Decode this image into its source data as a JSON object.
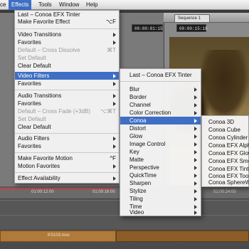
{
  "menubar": {
    "items": [
      {
        "label": "ce"
      },
      {
        "label": "Effects"
      },
      {
        "label": "Tools"
      },
      {
        "label": "Window"
      },
      {
        "label": "Help"
      }
    ]
  },
  "effects_menu": {
    "items": [
      {
        "label": "Last – Conoa EFX Tinter",
        "shortcut": "",
        "submenu": false,
        "disabled": false
      },
      {
        "label": "Make Favorite Effect",
        "shortcut": "⌥F",
        "submenu": false,
        "disabled": false
      },
      {
        "label": "Video Transitions",
        "shortcut": "",
        "submenu": true,
        "disabled": false
      },
      {
        "label": "Favorites",
        "shortcut": "",
        "submenu": true,
        "disabled": false
      },
      {
        "label": "Default – Cross Dissolve",
        "shortcut": "⌘T",
        "submenu": false,
        "disabled": true
      },
      {
        "label": "Set Default",
        "shortcut": "",
        "submenu": false,
        "disabled": true
      },
      {
        "label": "Clear Default",
        "shortcut": "",
        "submenu": false,
        "disabled": false
      },
      {
        "label": "Video Filters",
        "shortcut": "",
        "submenu": true,
        "disabled": false,
        "highlighted": true
      },
      {
        "label": "Favorites",
        "shortcut": "",
        "submenu": true,
        "disabled": false
      },
      {
        "label": "Audio Transitions",
        "shortcut": "",
        "submenu": true,
        "disabled": false
      },
      {
        "label": "Favorites",
        "shortcut": "",
        "submenu": true,
        "disabled": false
      },
      {
        "label": "Default – Cross Fade (+3dB)",
        "shortcut": "⌥⌘T",
        "submenu": false,
        "disabled": true
      },
      {
        "label": "Set Default",
        "shortcut": "",
        "submenu": false,
        "disabled": true
      },
      {
        "label": "Clear Default",
        "shortcut": "",
        "submenu": false,
        "disabled": false
      },
      {
        "label": "Audio Filters",
        "shortcut": "",
        "submenu": true,
        "disabled": false
      },
      {
        "label": "Favorites",
        "shortcut": "",
        "submenu": true,
        "disabled": false
      },
      {
        "label": "Make Favorite Motion",
        "shortcut": "^F",
        "submenu": false,
        "disabled": false
      },
      {
        "label": "Motion Favorites",
        "shortcut": "",
        "submenu": true,
        "disabled": false
      },
      {
        "label": "Effect Availability",
        "shortcut": "",
        "submenu": true,
        "disabled": false
      }
    ]
  },
  "video_filters_menu": {
    "items": [
      {
        "label": "Last – Conoa EFX Tinter",
        "submenu": false
      },
      {
        "label": "Blur",
        "submenu": true
      },
      {
        "label": "Border",
        "submenu": true
      },
      {
        "label": "Channel",
        "submenu": true
      },
      {
        "label": "Color Correction",
        "submenu": true
      },
      {
        "label": "Conoa",
        "submenu": true,
        "highlighted": true
      },
      {
        "label": "Distort",
        "submenu": true
      },
      {
        "label": "Glow",
        "submenu": true
      },
      {
        "label": "Image Control",
        "submenu": true
      },
      {
        "label": "Key",
        "submenu": true
      },
      {
        "label": "Matte",
        "submenu": true
      },
      {
        "label": "Perspective",
        "submenu": true
      },
      {
        "label": "QuickTime",
        "submenu": true
      },
      {
        "label": "Sharpen",
        "submenu": true
      },
      {
        "label": "Stylize",
        "submenu": true
      },
      {
        "label": "Tiling",
        "submenu": true
      },
      {
        "label": "Time",
        "submenu": true
      },
      {
        "label": "Video",
        "submenu": true
      }
    ]
  },
  "conoa_menu": {
    "items": [
      {
        "label": "Conoa 3D"
      },
      {
        "label": "Conoa Cube"
      },
      {
        "label": "Conoa Cylinder"
      },
      {
        "label": "Conoa EFX Alpha"
      },
      {
        "label": "Conoa EFX Glow"
      },
      {
        "label": "Conoa EFX Smooth"
      },
      {
        "label": "Conoa EFX Tinter"
      },
      {
        "label": "Conoa EFX Toon"
      },
      {
        "label": "Conoa SphereWarp"
      }
    ]
  },
  "background": {
    "sequence_tab": "Sequence 1",
    "timecode_left": "00:00:01:15",
    "timecode_right": "00:00:15:18",
    "ruler_labels": [
      "01:00:12:00",
      "01:00:16:00",
      "01:00:24:00"
    ],
    "clip_label": "KS103.mov"
  },
  "colors": {
    "highlight": "#3f6fc4",
    "menu_bg": "#f4f4f4",
    "disabled_text": "#9a9a9a"
  }
}
